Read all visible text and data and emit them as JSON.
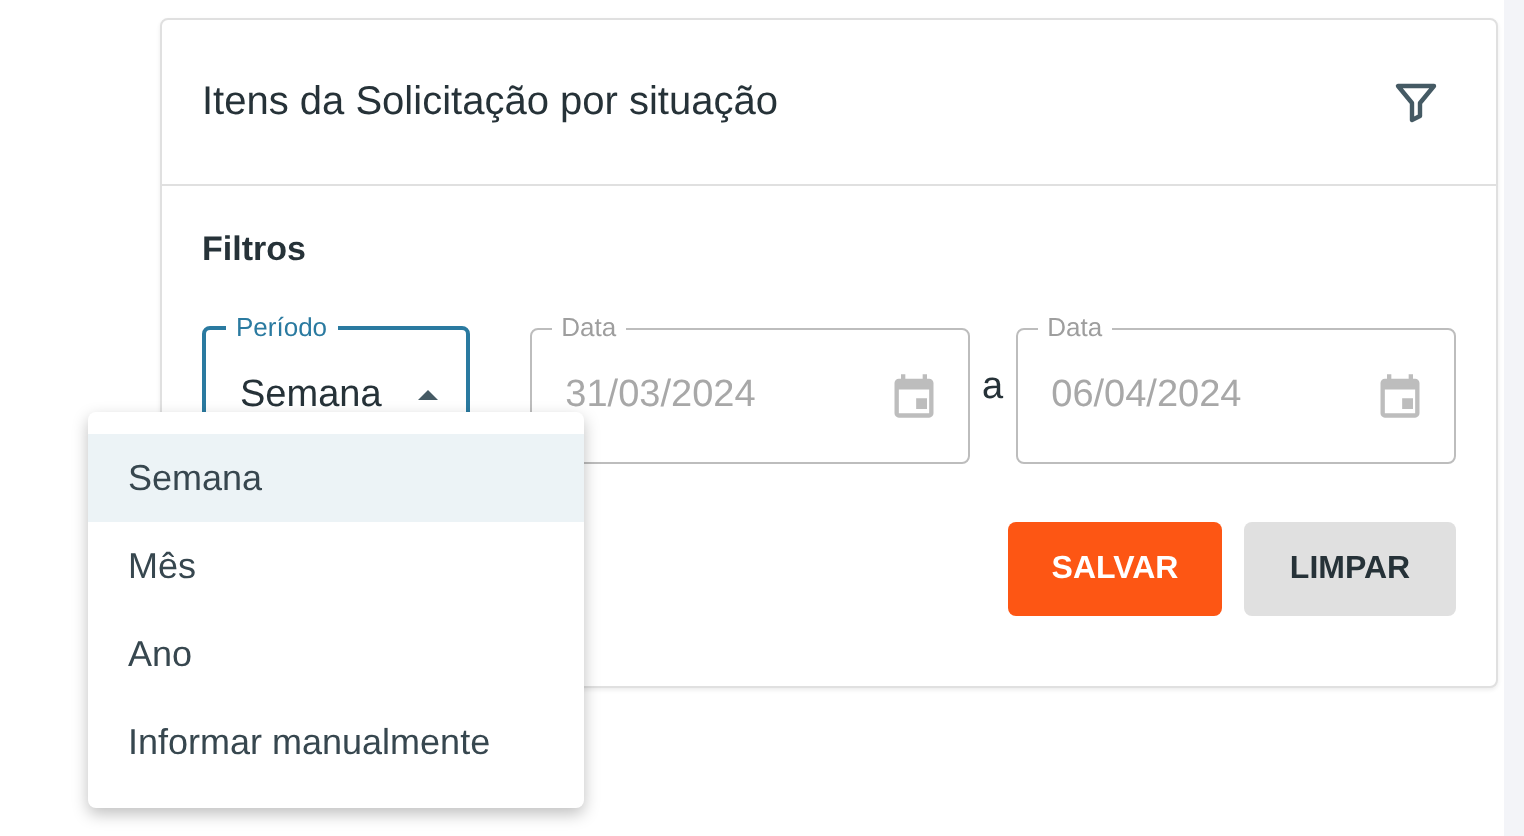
{
  "card": {
    "title": "Itens da Solicitação por situação",
    "section_title": "Filtros"
  },
  "period_select": {
    "label": "Período",
    "value": "Semana",
    "expanded": true
  },
  "date_fields": [
    {
      "label": "Data",
      "value": "31/03/2024",
      "disabled": true
    },
    {
      "label": "Data",
      "value": "06/04/2024",
      "disabled": true
    }
  ],
  "range_separator": "a",
  "buttons": [
    {
      "label": "SALVAR",
      "kind": "primary"
    },
    {
      "label": "LIMPAR",
      "kind": "secondary"
    }
  ],
  "menu": [
    {
      "label": "Semana",
      "selected": true
    },
    {
      "label": "Mês",
      "selected": false
    },
    {
      "label": "Ano",
      "selected": false
    },
    {
      "label": "Informar manualmente",
      "selected": false
    }
  ]
}
